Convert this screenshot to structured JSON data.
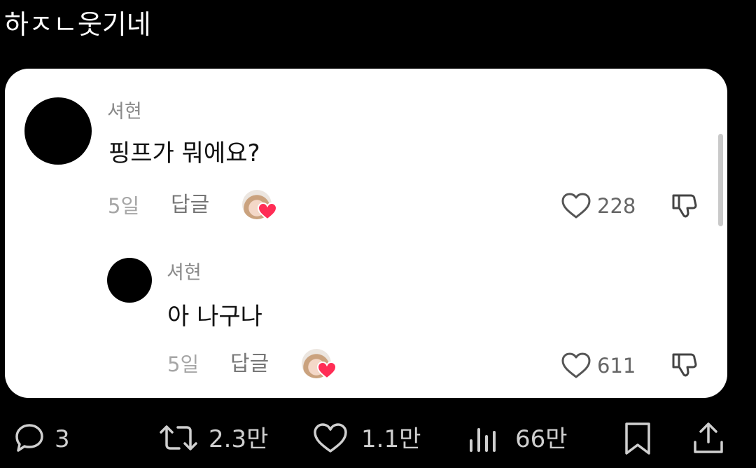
{
  "post": {
    "text": "하ㅈㄴ웃기네"
  },
  "comments": [
    {
      "username": "셔현",
      "text": "핑프가 뭐에요?",
      "time": "5일",
      "reply_label": "답글",
      "likes": "228",
      "liked_by_creator": true
    },
    {
      "username": "셔현",
      "text": "아 나구나",
      "time": "5일",
      "reply_label": "답글",
      "likes": "611",
      "liked_by_creator": true
    }
  ],
  "actions": {
    "replies": "3",
    "reposts": "2.3만",
    "likes": "1.1만",
    "views": "66만"
  },
  "colors": {
    "background": "#000000",
    "card": "#ffffff",
    "creator_heart": "#ff2d55",
    "muted_text": "#8b8b8b",
    "action_icon": "#cfcfcf"
  }
}
